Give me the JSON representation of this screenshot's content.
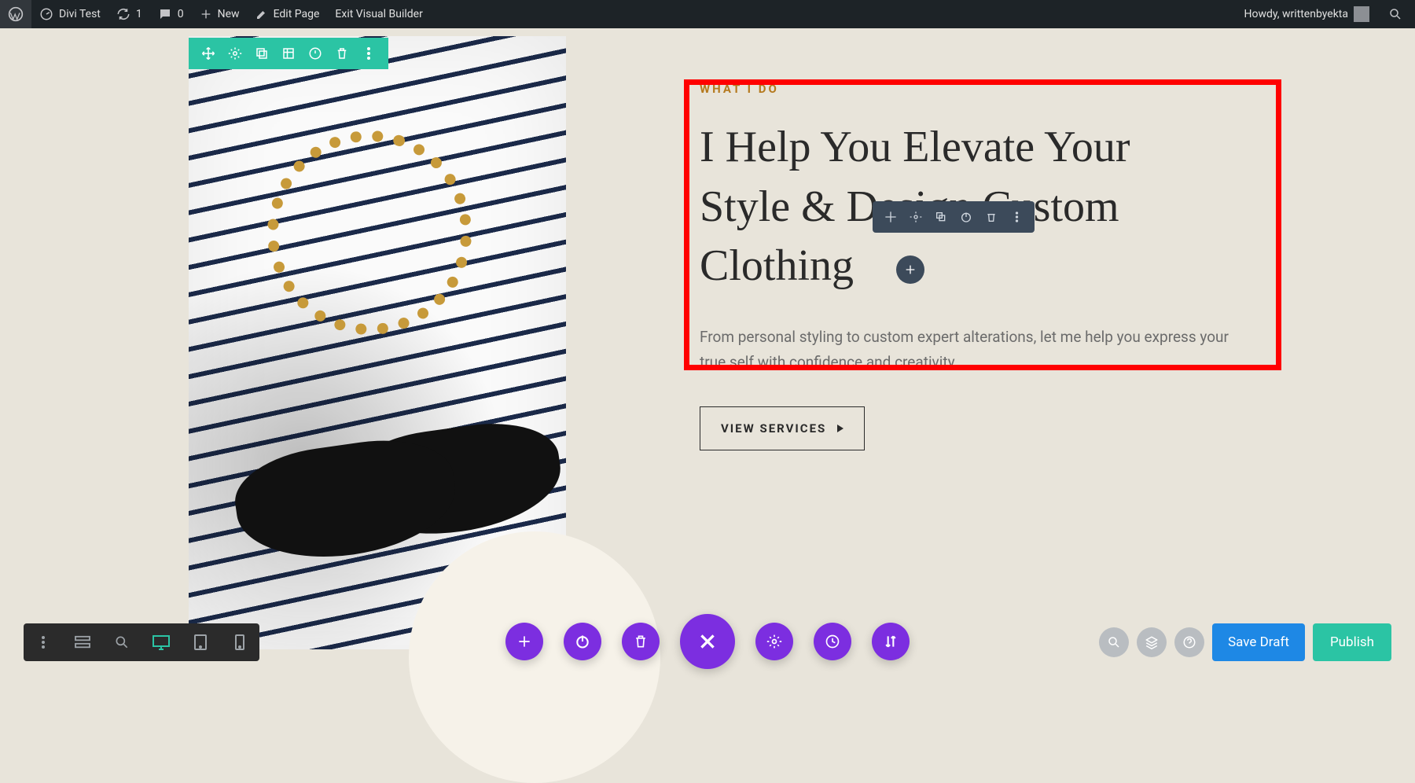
{
  "adminbar": {
    "site_name": "Divi Test",
    "updates": "1",
    "comments": "0",
    "new": "New",
    "edit_page": "Edit Page",
    "exit_vb": "Exit Visual Builder",
    "howdy": "Howdy, writtenbyekta"
  },
  "content": {
    "eyebrow": "WHAT I DO",
    "headline_line1": "I Help You Elevate Your",
    "headline_line2": "Style & Design Custom",
    "headline_line3": "Clothing",
    "body": "From personal styling  to custom expert alterations, let me help you express your true self with confidence and creativity.",
    "cta": "VIEW SERVICES"
  },
  "builder": {
    "save_draft": "Save Draft",
    "publish": "Publish"
  }
}
